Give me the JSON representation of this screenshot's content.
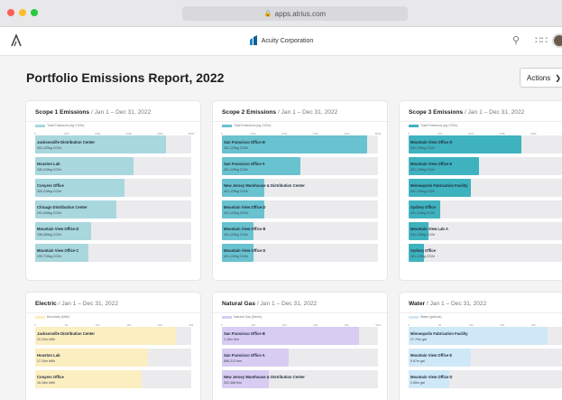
{
  "browser": {
    "url": "apps.atrius.com",
    "dots": [
      "#fe5f57",
      "#febc2e",
      "#28c840"
    ]
  },
  "app": {
    "brand": "Acuity Corporation",
    "brand_color": "#1a86c8",
    "icons": [
      "search-icon",
      "apps-grid-icon",
      "avatar"
    ]
  },
  "page": {
    "title": "Portfolio Emissions Report, 2022",
    "actions_label": "Actions"
  },
  "cards": [
    {
      "title": "Scope 1 Emissions",
      "range": " / Jan 1 – Dec 31, 2022",
      "legend": "Total Emissions (kg CO2e)",
      "color": "#a8d7de",
      "axis": [
        "0",
        "100k",
        "200k",
        "300k",
        "400k",
        "500k"
      ],
      "rows": [
        {
          "name": "Jacksonville Distribution Center",
          "value": "451,129kg CO2e",
          "fraction": 0.84
        },
        {
          "name": "Houston Lab",
          "value": "340,419kg CO2e",
          "fraction": 0.63
        },
        {
          "name": "Conyers Office",
          "value": "309,218kg CO2e",
          "fraction": 0.57
        },
        {
          "name": "Chicago Distribution Center",
          "value": "291,845kg CO2e",
          "fraction": 0.52
        },
        {
          "name": "Mountain View Office D",
          "value": "196,459kg CO2e",
          "fraction": 0.36
        },
        {
          "name": "Mountain View Office C",
          "value": "199,719kg CO2e",
          "fraction": 0.34
        }
      ]
    },
    {
      "title": "Scope 2 Emissions",
      "range": " / Jan 1 – Dec 31, 2022",
      "legend": "Total Emissions (kg CO2e)",
      "color": "#69c2cf",
      "axis": [
        "0",
        "100k",
        "200k",
        "300k",
        "400k",
        "500k"
      ],
      "rows": [
        {
          "name": "San Francisco Office B",
          "value": "451,129kg CO2e",
          "fraction": 0.93
        },
        {
          "name": "San Francisco Office A",
          "value": "401,129kg CO2e",
          "fraction": 0.5
        },
        {
          "name": "New Jersey Warehouse & Distribution Center",
          "value": "401,129kg CO2e",
          "fraction": 0.27
        },
        {
          "name": "Mountain View Office D",
          "value": "401,129kg CO2e",
          "fraction": 0.27
        },
        {
          "name": "Mountain View Office B",
          "value": "401,129kg CO2e",
          "fraction": 0.2
        },
        {
          "name": "Mountain View Office D",
          "value": "401,129kg CO2e",
          "fraction": 0.2
        }
      ]
    },
    {
      "title": "Scope 3 Emissions",
      "range": " / Jan 1 – Dec 31, 2022",
      "legend": "Total Emissions (kg CO2e)",
      "color": "#3fb2bf",
      "axis": [
        "0",
        "100k",
        "200k",
        "300k",
        "400k",
        "500k"
      ],
      "rows": [
        {
          "name": "Mountain View Office D",
          "value": "451,129kg CO2e",
          "fraction": 0.72
        },
        {
          "name": "Mountain View Office E",
          "value": "401,129kg CO2e",
          "fraction": 0.45
        },
        {
          "name": "Minneapolis Fabrication Facility",
          "value": "401,129kg CO2e",
          "fraction": 0.4
        },
        {
          "name": "Sydney Office",
          "value": "401,129kg CO2e",
          "fraction": 0.2
        },
        {
          "name": "Mountain View Lab A",
          "value": "401,129kg CO2e",
          "fraction": 0.13
        },
        {
          "name": "Sydney Office",
          "value": "401,129kg CO2e",
          "fraction": 0.1
        }
      ]
    },
    {
      "title": "Electric",
      "range": " / Jan 1 – Dec 31, 2022",
      "legend": "Electricity (kWh)",
      "color": "#fbeec0",
      "axis": [
        "0",
        "5k",
        "10k",
        "15k",
        "20k",
        "25k"
      ],
      "rows": [
        {
          "name": "Jacksonville Distribution Center",
          "value": "22.12m kWh",
          "fraction": 0.9
        },
        {
          "name": "Houston Lab",
          "value": "17.19m kWh",
          "fraction": 0.72
        },
        {
          "name": "Conyers Office",
          "value": "16.18m kWh",
          "fraction": 0.68
        }
      ]
    },
    {
      "title": "Natural Gas",
      "range": " / Jan 1 – Dec 31, 2022",
      "legend": "Natural Gas (therm)",
      "color": "#d8ccf2",
      "axis": [
        "0",
        "100",
        "200",
        "300",
        "400",
        "500"
      ],
      "rows": [
        {
          "name": "San Francisco Office B",
          "value": "1.16m thm",
          "fraction": 0.88
        },
        {
          "name": "San Francisco Office A",
          "value": "886,313 thm",
          "fraction": 0.43
        },
        {
          "name": "New Jersey Warehouse & Distribution Center",
          "value": "302,468 thm",
          "fraction": 0.3
        }
      ]
    },
    {
      "title": "Water",
      "range": " / Jan 1 – Dec 31, 2022",
      "legend": "Water (gallons)",
      "color": "#cfe8f7",
      "axis": [
        "0",
        "5k",
        "10k",
        "15k",
        "20k",
        "25k"
      ],
      "rows": [
        {
          "name": "Minneapolis Fabrication Facility",
          "value": "27.79m gal",
          "fraction": 0.89
        },
        {
          "name": "Mountain View Office E",
          "value": "5.67m gal",
          "fraction": 0.4
        },
        {
          "name": "Mountain View Office D",
          "value": "2.85m gal",
          "fraction": 0.26
        }
      ]
    }
  ]
}
